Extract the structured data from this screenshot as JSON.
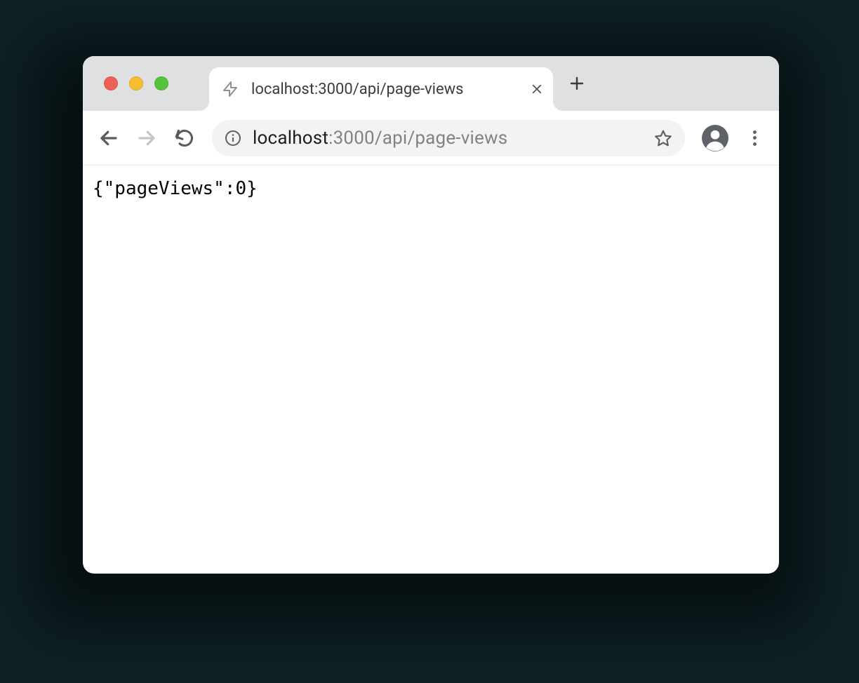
{
  "tab": {
    "title": "localhost:3000/api/page-views",
    "favicon": "lightning-icon"
  },
  "addressbar": {
    "host": "localhost",
    "rest": ":3000/api/page-views"
  },
  "page": {
    "body_text": "{\"pageViews\":0}"
  }
}
